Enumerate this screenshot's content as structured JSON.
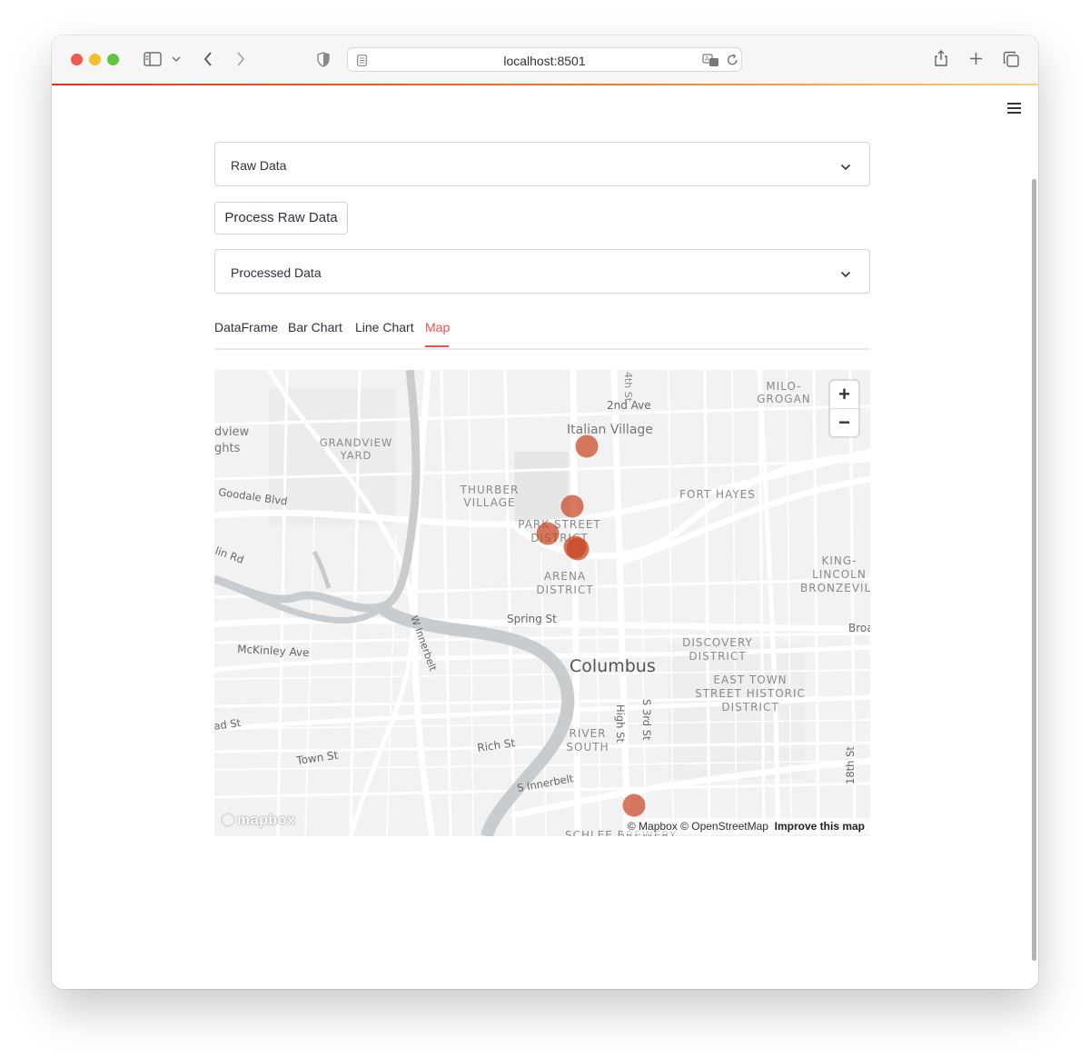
{
  "browser": {
    "url": "localhost:8501",
    "icons": [
      "sidebar-icon",
      "chevron-down-icon",
      "back-icon",
      "forward-icon",
      "shield-icon",
      "page-icon",
      "translate-icon",
      "reload-icon",
      "share-icon",
      "new-tab-icon",
      "tabs-overview-icon"
    ]
  },
  "app": {
    "menu_icon": "hamburger-icon",
    "raw_expander_label": "Raw Data",
    "process_button_label": "Process Raw Data",
    "processed_expander_label": "Processed Data",
    "tabs": [
      {
        "label": "DataFrame",
        "active": false
      },
      {
        "label": "Bar Chart",
        "active": false
      },
      {
        "label": "Line Chart",
        "active": false
      },
      {
        "label": "Map",
        "active": true
      }
    ],
    "accent_color": "#ff4b4b"
  },
  "map": {
    "zoom_in": "+",
    "zoom_out": "−",
    "attribution": "© Mapbox © OpenStreetMap",
    "improve_link": "Improve this map",
    "logo_text": "mapbox",
    "point_color": "#c8411e",
    "labels": {
      "milo": "MILO-",
      "grogan": "GROGAN",
      "2nd_ave": "2nd Ave",
      "4th_st": "4th St",
      "italian_village": "Italian Village",
      "grandview_heights_1": "dview",
      "grandview_heights_2": "ghts",
      "grandview_yard_1": "GRANDVIEW",
      "grandview_yard_2": "YARD",
      "thurber_1": "THURBER",
      "thurber_2": "VILLAGE",
      "fort_hayes": "FORT HAYES",
      "goodale": "Goodale Blvd",
      "park_street_1": "PARK STREET",
      "park_street_2": "DISTRICT",
      "olin_rd": "lin Rd",
      "king_1": "KING-",
      "king_2": "LINCOLN",
      "king_3": "BRONZEVILL",
      "arena_1": "ARENA",
      "arena_2": "DISTRICT",
      "spring_st": "Spring St",
      "w_innerbelt": "W Innerbelt",
      "broad": "Broa",
      "mckinley": "McKinley Ave",
      "discovery_1": "DISCOVERY",
      "discovery_2": "DISTRICT",
      "columbus": "Columbus",
      "east_town_1": "EAST TOWN",
      "east_town_2": "STREET HISTORIC",
      "east_town_3": "DISTRICT",
      "high_st": "High St",
      "s_3rd_st": "S 3rd St",
      "broad_st": "ad St",
      "river_south_1": "RIVER",
      "river_south_2": "SOUTH",
      "rich_st": "Rich St",
      "town_st": "Town St",
      "s_innerbelt": "S Innerbelt",
      "18th_st": "18th St",
      "schlee": "SCHLEE BREWERY"
    }
  }
}
